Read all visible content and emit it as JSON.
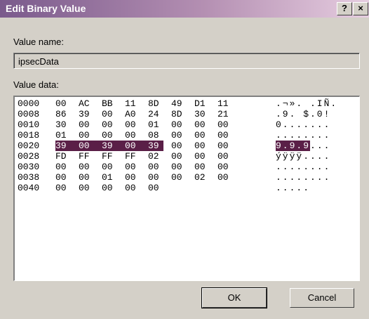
{
  "window": {
    "title": "Edit Binary Value",
    "help_button": "?",
    "close_button": "×"
  },
  "value_name": {
    "label": "Value name:",
    "value": "ipsecData"
  },
  "value_data": {
    "label": "Value data:",
    "rows": [
      {
        "addr": "0000",
        "bytes": [
          "00",
          "AC",
          "BB",
          "11",
          "8D",
          "49",
          "D1",
          "11"
        ],
        "ascii": ".¬». .IÑ."
      },
      {
        "addr": "0008",
        "bytes": [
          "86",
          "39",
          "00",
          "A0",
          "24",
          "8D",
          "30",
          "21"
        ],
        "ascii": ".9. $.0!"
      },
      {
        "addr": "0010",
        "bytes": [
          "30",
          "00",
          "00",
          "00",
          "01",
          "00",
          "00",
          "00"
        ],
        "ascii": "0......."
      },
      {
        "addr": "0018",
        "bytes": [
          "01",
          "00",
          "00",
          "00",
          "08",
          "00",
          "00",
          "00"
        ],
        "ascii": "........"
      },
      {
        "addr": "0020",
        "bytes": [
          "39",
          "00",
          "39",
          "00",
          "39",
          "00",
          "00",
          "00"
        ],
        "ascii": "9.9.9..."
      },
      {
        "addr": "0028",
        "bytes": [
          "FD",
          "FF",
          "FF",
          "FF",
          "02",
          "00",
          "00",
          "00"
        ],
        "ascii": "ýÿÿÿ...."
      },
      {
        "addr": "0030",
        "bytes": [
          "00",
          "00",
          "00",
          "00",
          "00",
          "00",
          "00",
          "00"
        ],
        "ascii": "........"
      },
      {
        "addr": "0038",
        "bytes": [
          "00",
          "00",
          "01",
          "00",
          "00",
          "00",
          "02",
          "00"
        ],
        "ascii": "........"
      },
      {
        "addr": "0040",
        "bytes": [
          "00",
          "00",
          "00",
          "00",
          "00"
        ],
        "ascii": "....."
      }
    ],
    "selection": {
      "row": 4,
      "byte_start": 0,
      "byte_end": 4,
      "ascii_selected": "9.9.9"
    }
  },
  "buttons": {
    "ok": "OK",
    "cancel": "Cancel"
  },
  "colors": {
    "selection": "#5a1f47",
    "titlebar_start": "#7a5a8c",
    "face": "#d4d0c8"
  }
}
